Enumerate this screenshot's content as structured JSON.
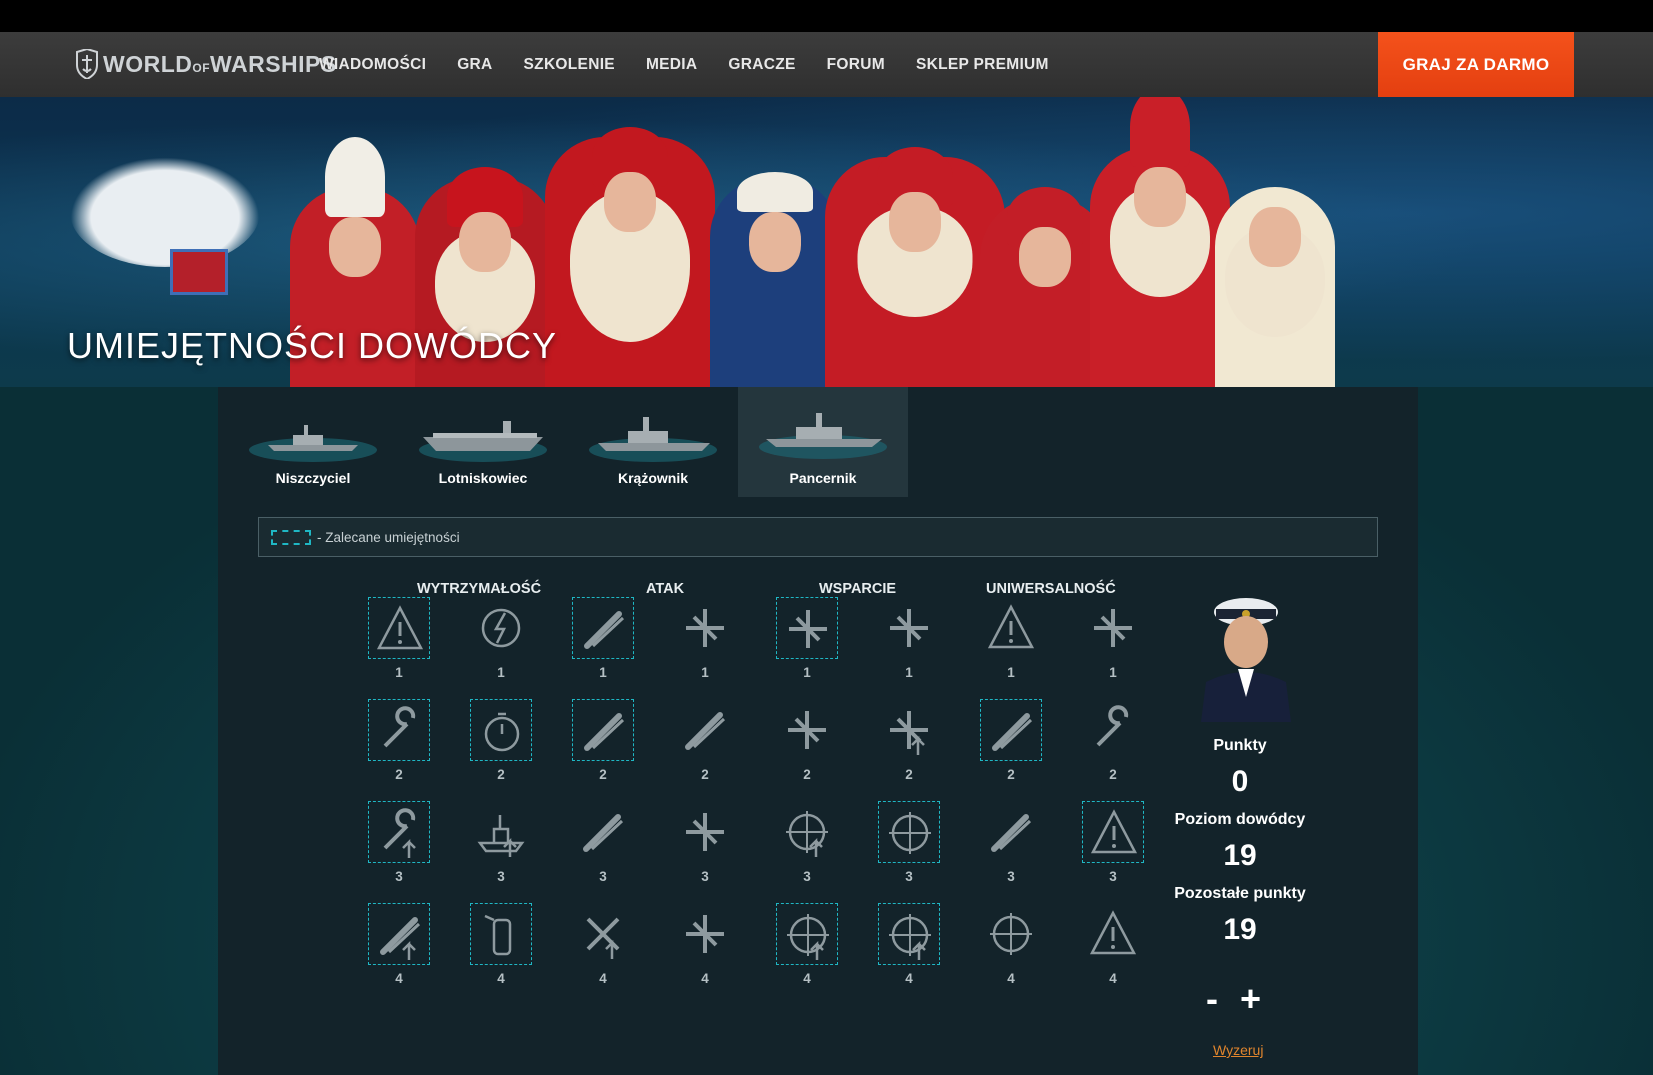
{
  "nav": {
    "logo": {
      "world": "WORLD",
      "of": "OF",
      "warships": "WARSHIPS"
    },
    "items": [
      {
        "label": "WIADOMOŚCI"
      },
      {
        "label": "GRA"
      },
      {
        "label": "SZKOLENIE"
      },
      {
        "label": "MEDIA"
      },
      {
        "label": "GRACZE"
      },
      {
        "label": "FORUM"
      },
      {
        "label": "SKLEP PREMIUM"
      }
    ],
    "cta": "GRAJ ZA DARMO"
  },
  "hero": {
    "title": "UMIEJĘTNOŚCI DOWÓDCY"
  },
  "ship_tabs": [
    {
      "label": "Niszczyciel",
      "active": false
    },
    {
      "label": "Lotniskowiec",
      "active": false
    },
    {
      "label": "Krążownik",
      "active": false
    },
    {
      "label": "Pancernik",
      "active": true
    }
  ],
  "legend": {
    "text": "- Zalecane umiejętności"
  },
  "categories": [
    "WYTRZYMAŁOŚĆ",
    "ATAK",
    "WSPARCIE",
    "UNIWERSALNOŚĆ"
  ],
  "skills": {
    "rows": [
      {
        "cost": "1",
        "cells": [
          {
            "icon": "warning-circle-icon",
            "recommended": true
          },
          {
            "icon": "no-lightning-icon",
            "recommended": false
          },
          {
            "icon": "torpedo-reload-icon",
            "recommended": true
          },
          {
            "icon": "plane-timer-icon",
            "recommended": false
          },
          {
            "icon": "aircraft-target-icon",
            "recommended": true
          },
          {
            "icon": "plane-radar-icon",
            "recommended": false
          },
          {
            "icon": "shell-warning-icon",
            "recommended": false
          },
          {
            "icon": "plane-bomb-plus-icon",
            "recommended": false
          }
        ]
      },
      {
        "cost": "2",
        "cells": [
          {
            "icon": "wrench-timer-icon",
            "recommended": true
          },
          {
            "icon": "stopwatch-icon",
            "recommended": true
          },
          {
            "icon": "gun-range-icon",
            "recommended": true
          },
          {
            "icon": "rocket-icon",
            "recommended": false
          },
          {
            "icon": "plane-upgrade-icon",
            "recommended": false
          },
          {
            "icon": "plane-arrow-icon",
            "recommended": false
          },
          {
            "icon": "shells-timer-icon",
            "recommended": true
          },
          {
            "icon": "helm-wrench-icon",
            "recommended": false
          }
        ]
      },
      {
        "cost": "3",
        "cells": [
          {
            "icon": "wrench-arrow-icon",
            "recommended": true
          },
          {
            "icon": "ship-arrow-icon",
            "recommended": false
          },
          {
            "icon": "torpedo-timer-icon",
            "recommended": false
          },
          {
            "icon": "plane-fire-icon",
            "recommended": false
          },
          {
            "icon": "aa-arrow-icon",
            "recommended": false
          },
          {
            "icon": "aa-plus-icon",
            "recommended": true
          },
          {
            "icon": "shell-fire-icon",
            "recommended": false
          },
          {
            "icon": "torpedo-warning-icon",
            "recommended": true
          }
        ]
      },
      {
        "cost": "4",
        "cells": [
          {
            "icon": "shells-arrow-icon",
            "recommended": true
          },
          {
            "icon": "extinguisher-icon",
            "recommended": true
          },
          {
            "icon": "crossed-arrow-icon",
            "recommended": false
          },
          {
            "icon": "planes-target-icon",
            "recommended": false
          },
          {
            "icon": "aa-double-arrow-icon",
            "recommended": true
          },
          {
            "icon": "crosshair-arrow-icon",
            "recommended": true
          },
          {
            "icon": "radar-icon",
            "recommended": false
          },
          {
            "icon": "warning-down-icon",
            "recommended": false
          }
        ]
      }
    ]
  },
  "stats": {
    "points_label": "Punkty",
    "points_value": "0",
    "level_label": "Poziom dowódcy",
    "level_value": "19",
    "remaining_label": "Pozostałe punkty",
    "remaining_value": "19",
    "minus": "-",
    "plus": "+",
    "reset": "Wyzeruj"
  }
}
